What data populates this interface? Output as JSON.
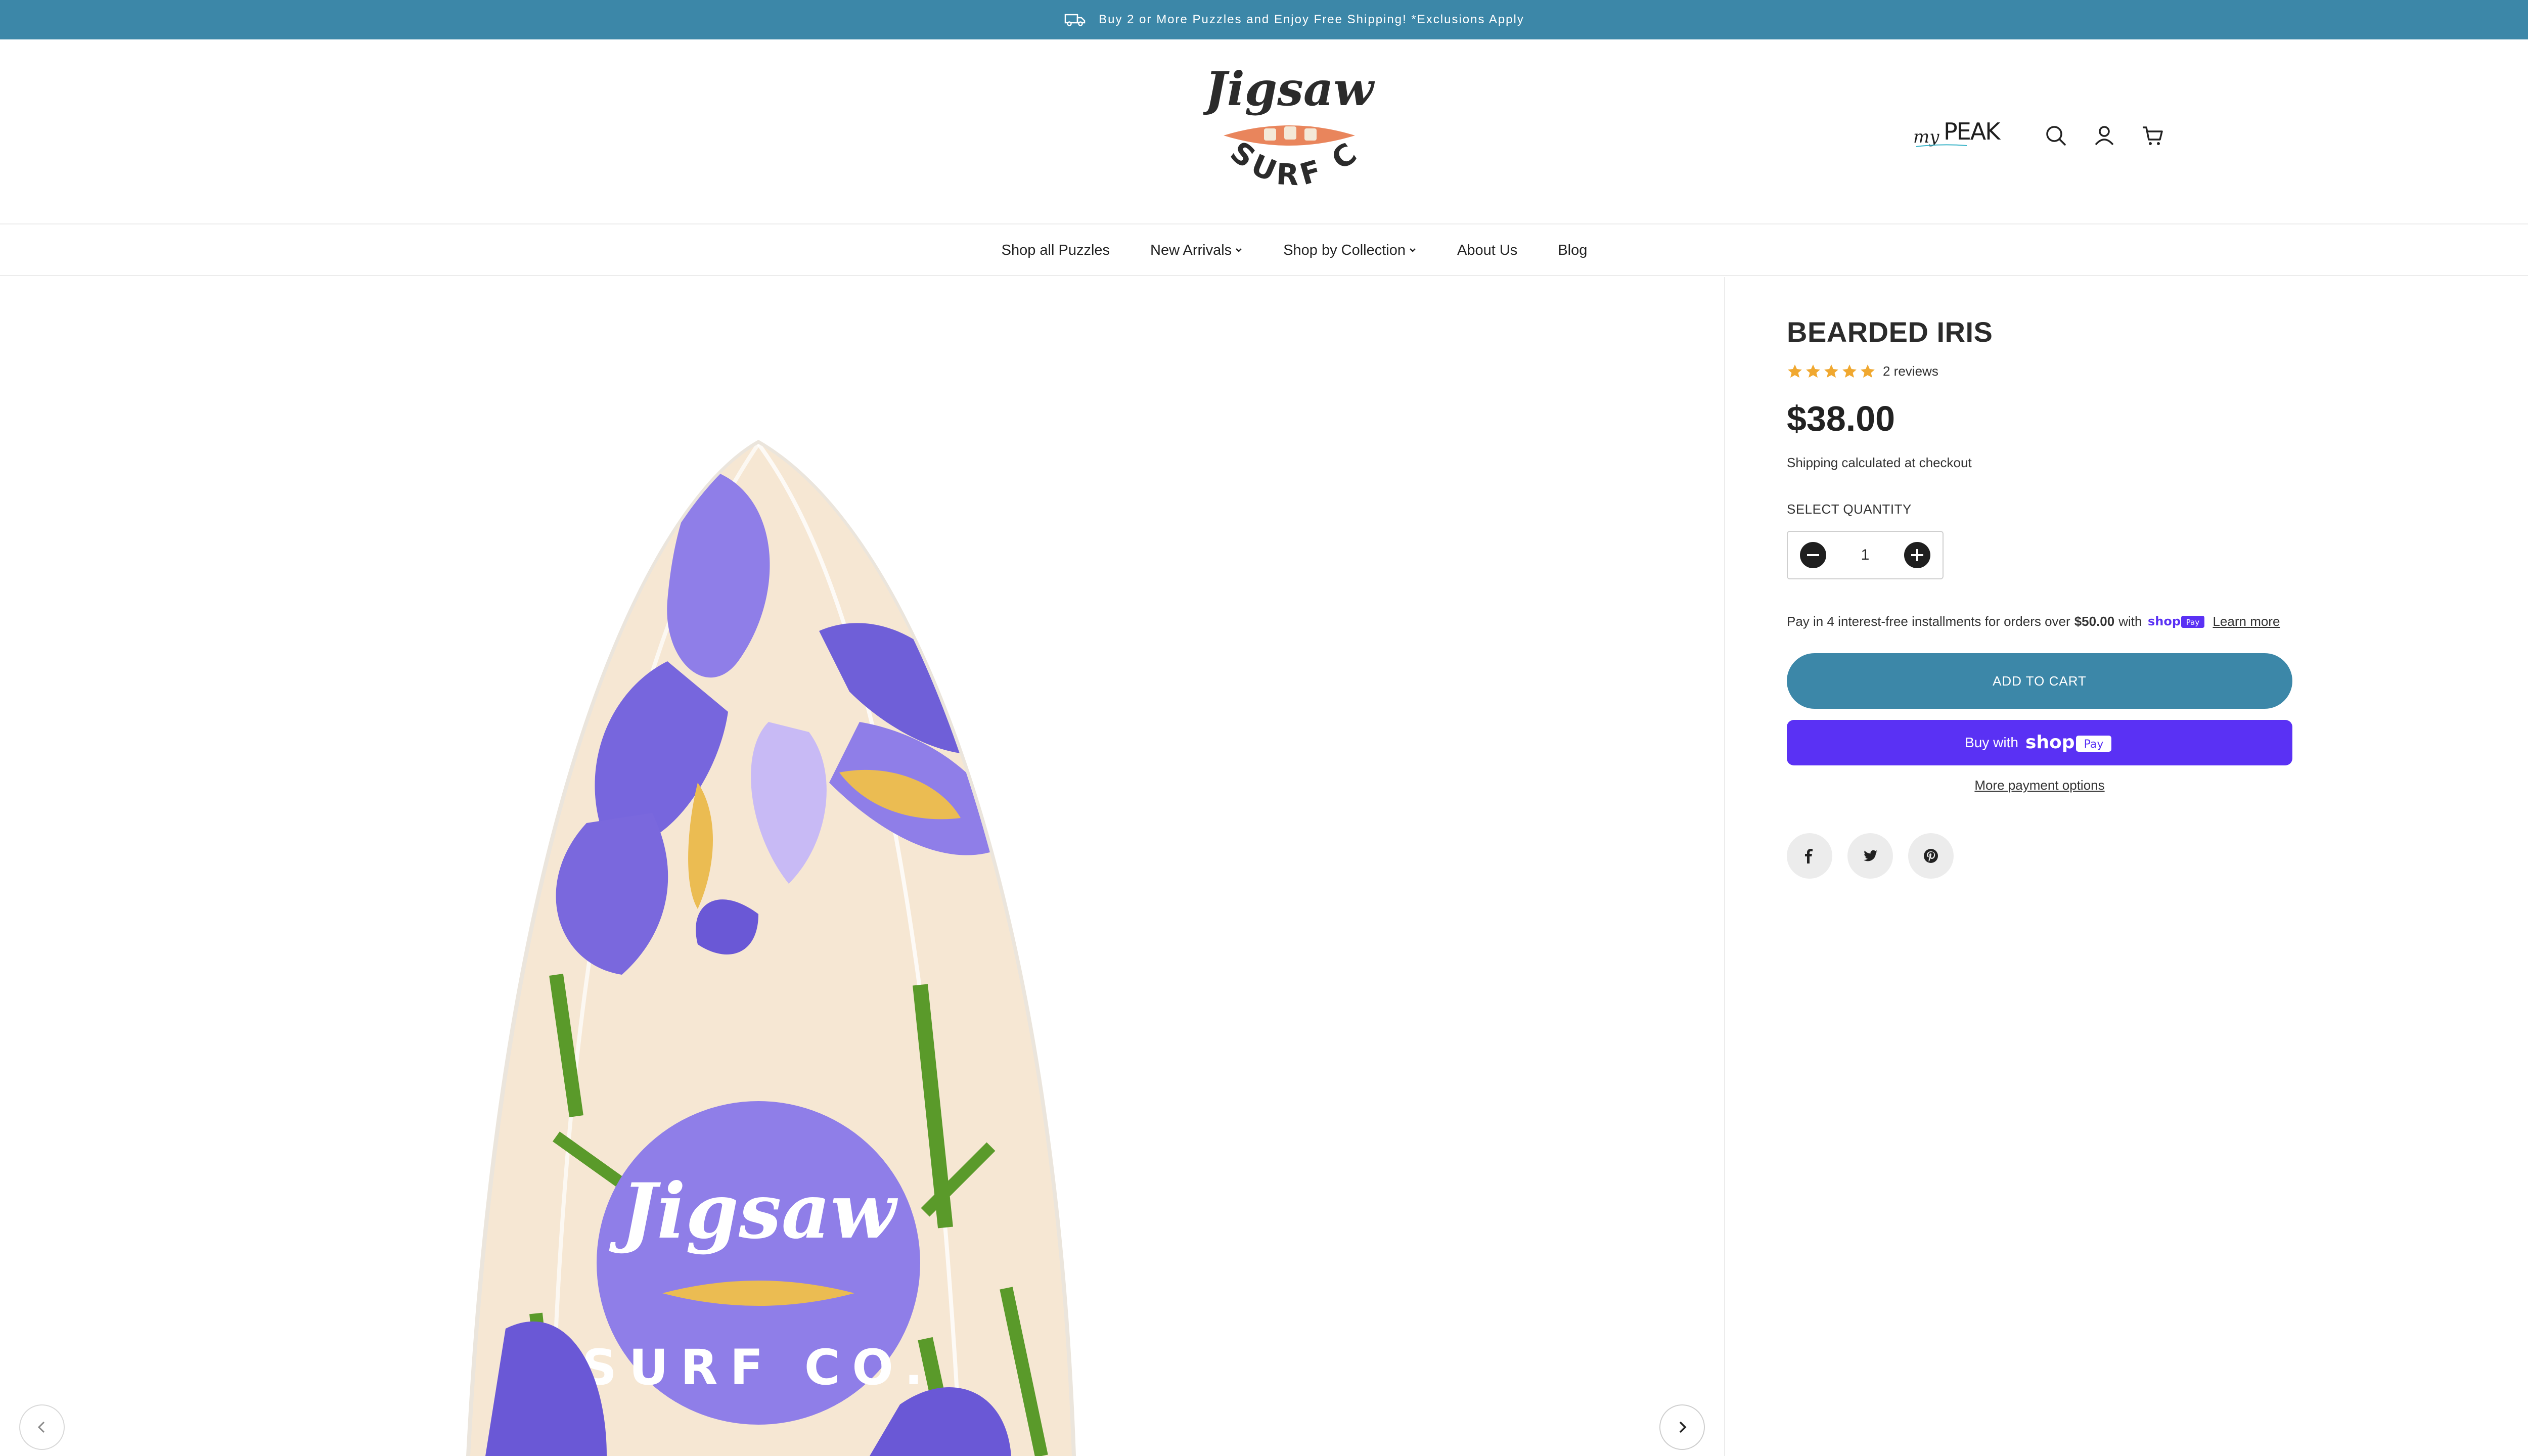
{
  "colors": {
    "brand": "#3c87a8",
    "shop_purple": "#5a31f4",
    "star": "#f0a830"
  },
  "announcement": {
    "text": "Buy 2 or More Puzzles and Enjoy Free Shipping! *Exclusions Apply",
    "icon": "truck-icon",
    "close_icon": "close-icon"
  },
  "header": {
    "logo_alt": "Jigsaw Surf Co.",
    "partner_logo": "myPEAK",
    "icons": [
      "search-icon",
      "account-icon",
      "cart-icon"
    ]
  },
  "nav": {
    "items": [
      {
        "label": "Shop all Puzzles",
        "dropdown": false
      },
      {
        "label": "New Arrivals",
        "dropdown": true
      },
      {
        "label": "Shop by Collection",
        "dropdown": true
      },
      {
        "label": "About Us",
        "dropdown": false
      },
      {
        "label": "Blog",
        "dropdown": false
      }
    ]
  },
  "gallery": {
    "prev_icon": "chevron-left-icon",
    "next_icon": "chevron-right-icon"
  },
  "product": {
    "title": "BEARDED IRIS",
    "rating_stars": 5,
    "reviews": "2 reviews",
    "price": "$38.00",
    "shipping_link": "Shipping",
    "shipping_rest": " calculated at checkout",
    "quantity_label": "SELECT QUANTITY",
    "quantity": "1",
    "installments_prefix": "Pay in 4 interest-free installments for orders over",
    "installments_amount": "$50.00",
    "installments_with": "with",
    "learn_more": "Learn more",
    "add_to_cart": "ADD TO CART",
    "buy_with": "Buy with",
    "more_payment": "More payment options"
  },
  "social": [
    "facebook-icon",
    "twitter-icon",
    "pinterest-icon"
  ]
}
